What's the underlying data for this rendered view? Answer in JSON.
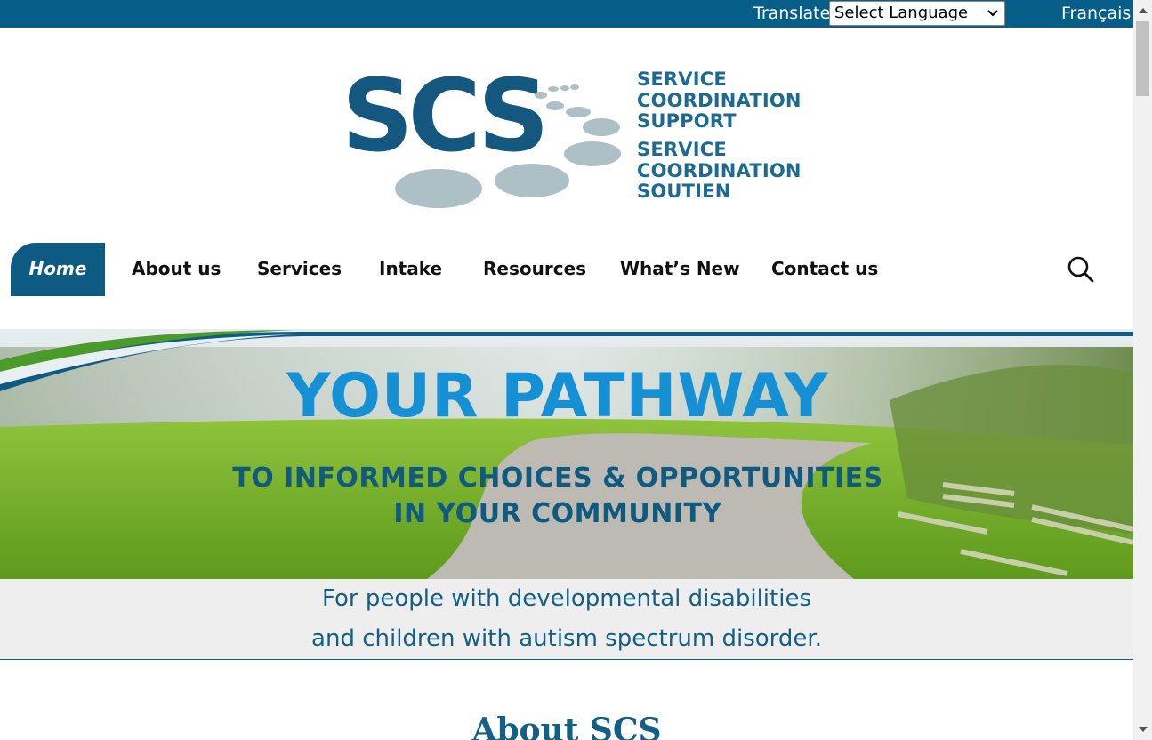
{
  "topbar": {
    "translate_label": "Translate:",
    "language_select": {
      "selected": "Select Language"
    },
    "french_link": "Français",
    "background_color": "#075e89"
  },
  "logo": {
    "letters": "SCS",
    "lines": [
      "SERVICE",
      "COORDINATION",
      "SUPPORT",
      "SERVICE",
      "COORDINATION",
      "SOUTIEN"
    ],
    "brand_color": "#14587f",
    "dot_color": "#adc0c6"
  },
  "nav": {
    "items": [
      {
        "label": "Home",
        "active": true
      },
      {
        "label": "About us"
      },
      {
        "label": "Services"
      },
      {
        "label": "Intake"
      },
      {
        "label": "Resources"
      },
      {
        "label": "What’s New"
      },
      {
        "label": "Contact us"
      }
    ],
    "search_icon": "search-icon",
    "active_color": "#0d5b83"
  },
  "hero": {
    "title": "YOUR PATHWAY",
    "subtitle_line1": "TO INFORMED CHOICES & OPPORTUNITIES",
    "subtitle_line2": "IN YOUR COMMUNITY"
  },
  "tagline": {
    "line1": "For people with developmental disabilities",
    "line2": "and children with autism spectrum disorder."
  },
  "about": {
    "heading": "About SCS"
  }
}
